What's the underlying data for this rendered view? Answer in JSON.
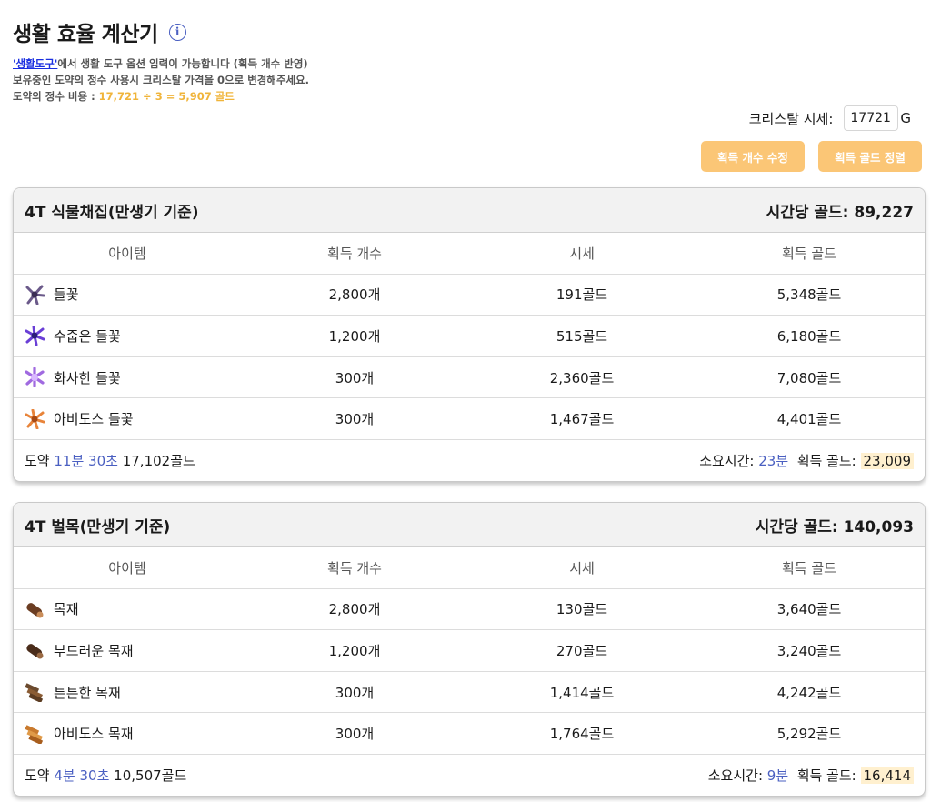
{
  "page": {
    "title": "생활 효율 계산기",
    "info_icon": "i",
    "note_link": "'생활도구'",
    "note_line1_rest": "에서 생활 도구 옵션 입력이 가능합니다 (획득 개수 반영)",
    "note_line2": "보유중인 도약의 정수 사용시 크리스탈 가격을 0으로 변경해주세요.",
    "note_line3_label": "도약의 정수 비용 :",
    "note_line3_value": "17,721 ÷ 3 = 5,907 골드"
  },
  "crystal": {
    "label": "크리스탈 시세:",
    "value": "17721",
    "unit": "G"
  },
  "buttons": {
    "edit_count": "획득 개수 수정",
    "sort_gold": "획득 골드 정렬"
  },
  "columns": [
    "아이템",
    "획득 개수",
    "시세",
    "획득 골드"
  ],
  "panels": [
    {
      "title": "4T 식물채집(만생기 기준)",
      "per_hour": "시간당 골드: 89,227",
      "items": [
        {
          "name": "들꽃",
          "count": "2,800개",
          "price": "191골드",
          "gold": "5,348골드",
          "icon": "flower-purple-icon"
        },
        {
          "name": "수줍은 들꽃",
          "count": "1,200개",
          "price": "515골드",
          "gold": "6,180골드",
          "icon": "flower-violet-icon"
        },
        {
          "name": "화사한 들꽃",
          "count": "300개",
          "price": "2,360골드",
          "gold": "7,080골드",
          "icon": "flower-bright-icon"
        },
        {
          "name": "아비도스 들꽃",
          "count": "300개",
          "price": "1,467골드",
          "gold": "4,401골드",
          "icon": "flower-orange-icon"
        }
      ],
      "foot": {
        "leap_label": "도약",
        "leap_time": "11분 30초",
        "leap_gold": "17,102골드",
        "time_label": "소요시간:",
        "time_value": "23분",
        "gold_label": "획득 골드:",
        "gold_value": "23,009"
      }
    },
    {
      "title": "4T 벌목(만생기 기준)",
      "per_hour": "시간당 골드: 140,093",
      "items": [
        {
          "name": "목재",
          "count": "2,800개",
          "price": "130골드",
          "gold": "3,640골드",
          "icon": "log-icon"
        },
        {
          "name": "부드러운 목재",
          "count": "1,200개",
          "price": "270골드",
          "gold": "3,240골드",
          "icon": "log-dark-icon"
        },
        {
          "name": "튼튼한 목재",
          "count": "300개",
          "price": "1,414골드",
          "gold": "4,242골드",
          "icon": "plank-icon"
        },
        {
          "name": "아비도스 목재",
          "count": "300개",
          "price": "1,764골드",
          "gold": "5,292골드",
          "icon": "plank-orange-icon"
        }
      ],
      "foot": {
        "leap_label": "도약",
        "leap_time": "4분 30초",
        "leap_gold": "10,507골드",
        "time_label": "소요시간:",
        "time_value": "9분",
        "gold_label": "획득 골드:",
        "gold_value": "16,414"
      }
    }
  ],
  "colors": {
    "accent_blue": "#4a5fc1",
    "button_orange": "#fbc676",
    "cost_yellow": "#f0b43a",
    "highlight": "#fff0cf"
  }
}
